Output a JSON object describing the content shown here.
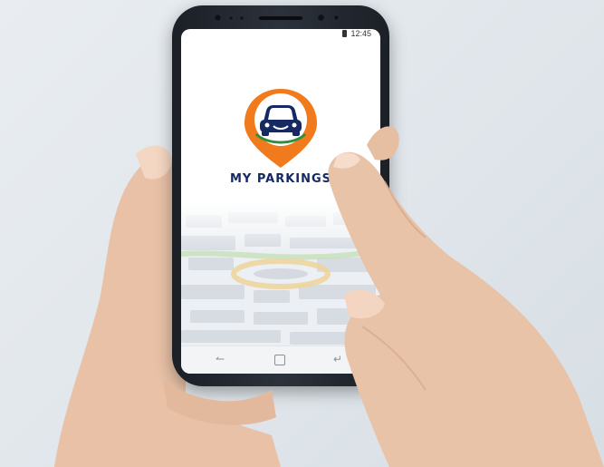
{
  "status_bar": {
    "time": "12:45"
  },
  "app": {
    "brand_name": "MY PARKINGS"
  },
  "colors": {
    "brand_orange": "#f07a1c",
    "brand_navy": "#152a63",
    "phone_body": "#1f242c"
  },
  "icons": [
    "battery-icon",
    "car-pin-logo-icon",
    "back-icon",
    "home-icon",
    "recents-icon"
  ]
}
